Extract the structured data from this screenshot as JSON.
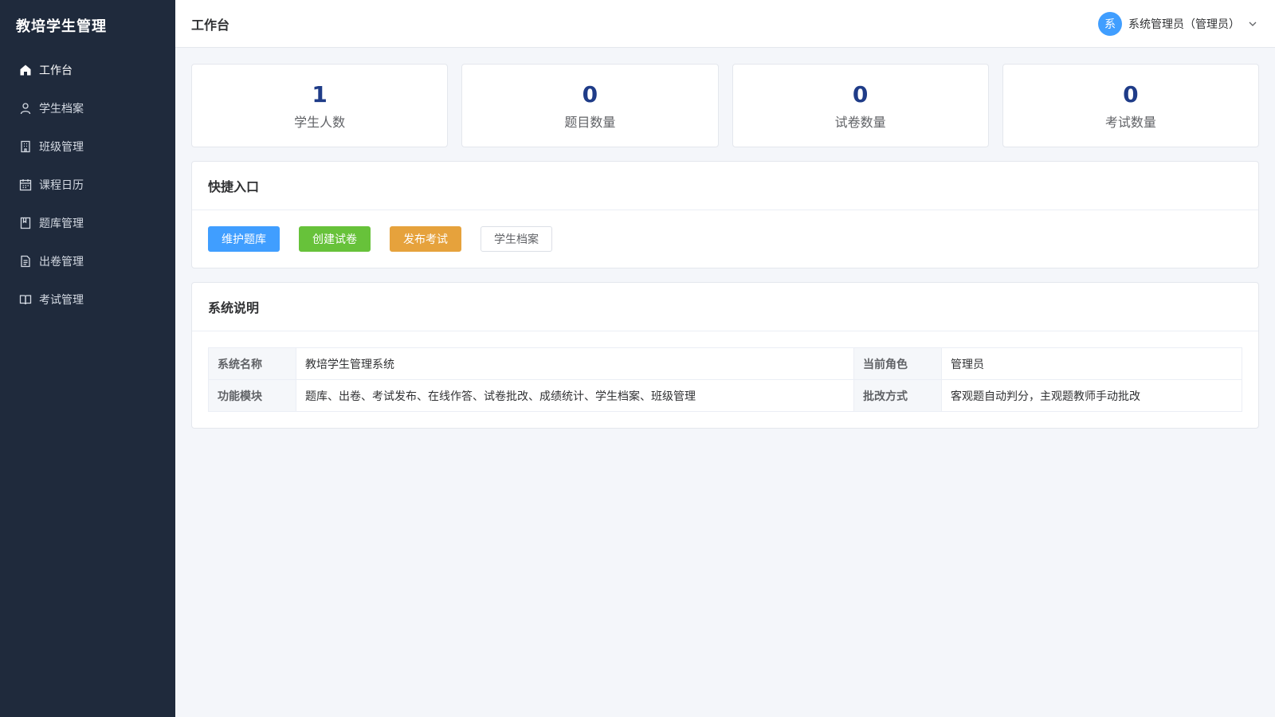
{
  "sidebar": {
    "brand": "教培学生管理",
    "items": [
      {
        "label": "工作台",
        "icon": "home-icon",
        "active": true
      },
      {
        "label": "学生档案",
        "icon": "user-icon"
      },
      {
        "label": "班级管理",
        "icon": "building-icon"
      },
      {
        "label": "课程日历",
        "icon": "calendar-icon"
      },
      {
        "label": "题库管理",
        "icon": "notebook-icon"
      },
      {
        "label": "出卷管理",
        "icon": "document-icon"
      },
      {
        "label": "考试管理",
        "icon": "book-icon"
      }
    ]
  },
  "header": {
    "title": "工作台",
    "avatar_text": "系",
    "user_name": "系统管理员（管理员）"
  },
  "stats": [
    {
      "value": "1",
      "label": "学生人数"
    },
    {
      "value": "0",
      "label": "题目数量"
    },
    {
      "value": "0",
      "label": "试卷数量"
    },
    {
      "value": "0",
      "label": "考试数量"
    }
  ],
  "quick": {
    "title": "快捷入口",
    "buttons": [
      {
        "label": "维护题库",
        "color": "#409eff"
      },
      {
        "label": "创建试卷",
        "color": "#67c23a"
      },
      {
        "label": "发布考试",
        "color": "#e6a23c"
      },
      {
        "label": "学生档案",
        "color": "#ffffff"
      }
    ]
  },
  "system": {
    "title": "系统说明",
    "rows": [
      {
        "k1": "系统名称",
        "v1": "教培学生管理系统",
        "k2": "当前角色",
        "v2": "管理员"
      },
      {
        "k1": "功能模块",
        "v1": "题库、出卷、考试发布、在线作答、试卷批改、成绩统计、学生档案、班级管理",
        "k2": "批改方式",
        "v2": "客观题自动判分，主观题教师手动批改"
      }
    ]
  },
  "colors": {
    "sidebar_bg": "#1f2a3c",
    "stat_value": "#1f3c88",
    "accent": "#409eff"
  }
}
